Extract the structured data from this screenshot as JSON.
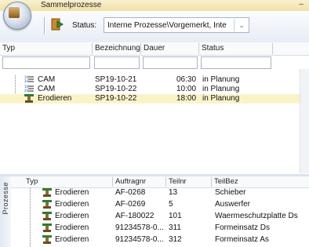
{
  "title": "Sammelprozesse",
  "toolbar": {
    "status_label": "Status:",
    "status_value": "Interne Prozesse\\Vorgemerkt, Inte"
  },
  "grid": {
    "columns": [
      "Typ",
      "Bezeichnung",
      "Dauer",
      "Status"
    ],
    "rows": [
      {
        "typ": "CAM",
        "icon": "cam-icon",
        "bezeichnung": "SP19-10-21",
        "dauer": "06:30",
        "status": "in Planung"
      },
      {
        "typ": "CAM",
        "icon": "cam-icon",
        "bezeichnung": "SP19-10-22",
        "dauer": "10:00",
        "status": "in Planung"
      },
      {
        "typ": "Erodieren",
        "icon": "erodieren-icon",
        "bezeichnung": "SP19-10-22",
        "dauer": "18:00",
        "status": "in Planung"
      }
    ]
  },
  "side_tab_label": "Prozesse",
  "subgrid": {
    "columns": [
      "Typ",
      "Auftragnr",
      "Teilnr",
      "TeilBez"
    ],
    "rows": [
      {
        "typ": "Erodieren",
        "auftragnr": "AF-0268",
        "teilnr": "13",
        "teilbez": "Schieber"
      },
      {
        "typ": "Erodieren",
        "auftragnr": "AF-0269",
        "teilnr": "5",
        "teilbez": "Auswerfer"
      },
      {
        "typ": "Erodieren",
        "auftragnr": "AF-180022",
        "teilnr": "101",
        "teilbez": "Waermeschutzplatte Ds"
      },
      {
        "typ": "Erodieren",
        "auftragnr": "91234578-0...",
        "teilnr": "311",
        "teilbez": "Formeinsatz Ds"
      },
      {
        "typ": "Erodieren",
        "auftragnr": "91234578-0...",
        "teilnr": "312",
        "teilbez": "Formeinsatz As"
      }
    ]
  },
  "colors": {
    "selected_row": "#fbf3c8",
    "accent": "#f1e2a6"
  }
}
